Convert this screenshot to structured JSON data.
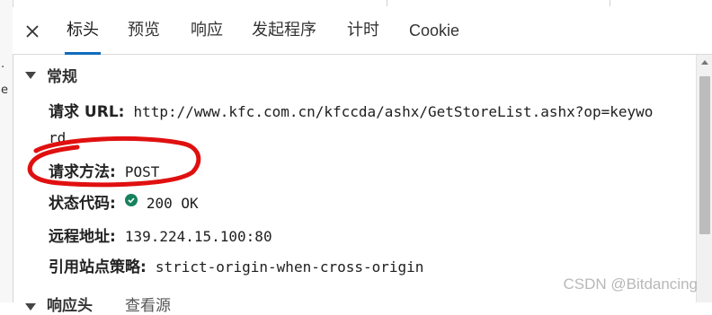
{
  "left_fragments": [
    ".",
    "e"
  ],
  "tabs": [
    {
      "label": "标头",
      "active": true
    },
    {
      "label": "预览"
    },
    {
      "label": "响应"
    },
    {
      "label": "发起程序"
    },
    {
      "label": "计时"
    },
    {
      "label": "Cookie"
    }
  ],
  "general": {
    "title": "常规",
    "request_url_label": "请求 URL:",
    "request_url_line1": "http://www.kfc.com.cn/kfccda/ashx/GetStoreList.ashx?op=keywo",
    "request_url_line2": "rd",
    "method_label": "请求方法:",
    "method_value": "POST",
    "status_label": "状态代码:",
    "status_value": "200 OK",
    "remote_label": "远程地址:",
    "remote_value": "139.224.15.100:80",
    "referrer_label": "引用站点策略:",
    "referrer_value": "strict-origin-when-cross-origin"
  },
  "next_section": {
    "title": "响应头",
    "view_source": "查看源"
  },
  "watermark": "CSDN @Bitdancing",
  "colors": {
    "accent": "#0f6cbd",
    "status_ok": "#16825d",
    "annotation": "#e01010"
  }
}
